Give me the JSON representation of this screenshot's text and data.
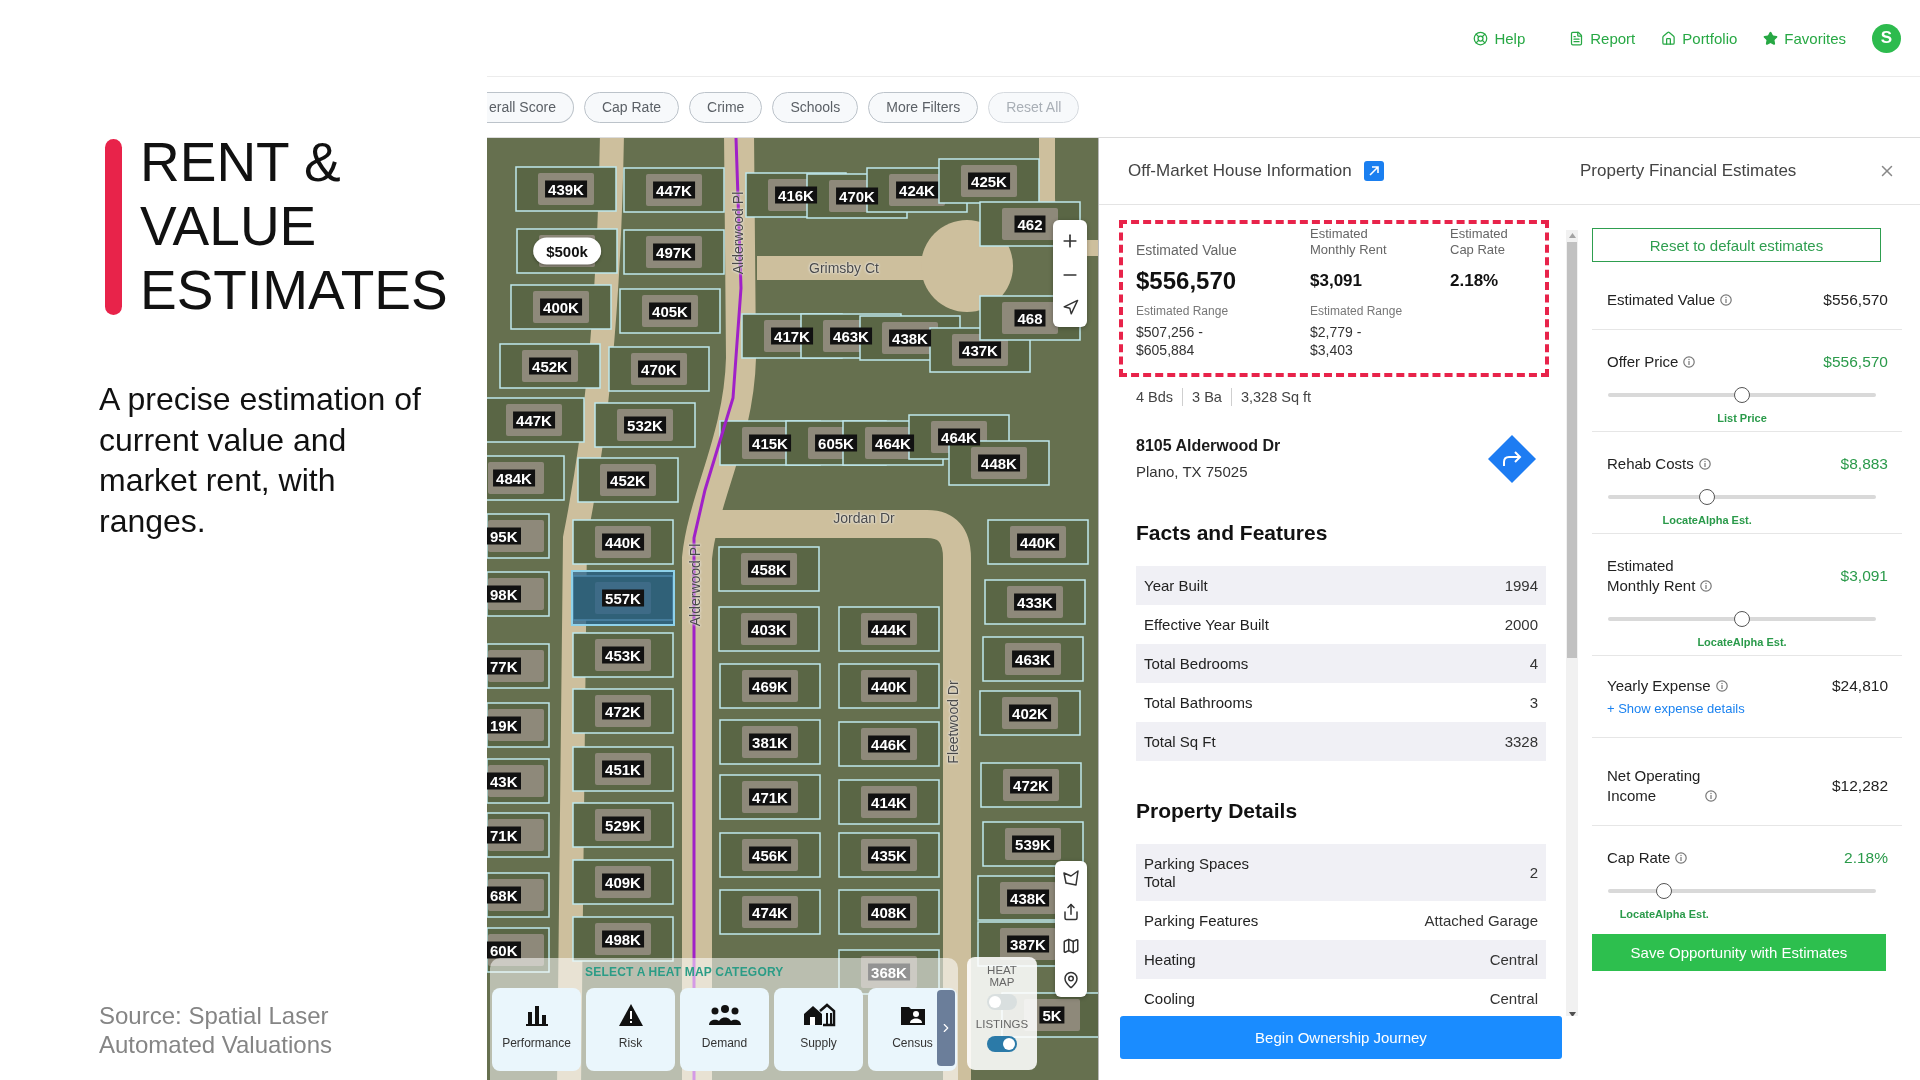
{
  "slide": {
    "title": "RENT & VALUE ESTIMATES",
    "summary": "A precise estimation of current value and market rent, with ranges.",
    "source": "Source: Spatial Laser Automated Valuations"
  },
  "top_nav": {
    "items": [
      {
        "kind": "help",
        "label": "Help"
      },
      {
        "kind": "report",
        "label": "Report"
      },
      {
        "kind": "portfolio",
        "label": "Portfolio"
      },
      {
        "kind": "favorites",
        "label": "Favorites"
      }
    ],
    "avatar": "S"
  },
  "filters": [
    {
      "label": "erall Score",
      "disabled": false
    },
    {
      "label": "Cap Rate",
      "disabled": false
    },
    {
      "label": "Crime",
      "disabled": false
    },
    {
      "label": "Schools",
      "disabled": false
    },
    {
      "label": "More Filters",
      "disabled": false
    },
    {
      "label": "Reset All",
      "disabled": true
    }
  ],
  "map": {
    "markers": [
      {
        "label": "439K",
        "kind": "price",
        "selected": false
      },
      {
        "label": "447K",
        "kind": "price",
        "selected": false
      },
      {
        "label": "416K",
        "kind": "price",
        "selected": false
      },
      {
        "label": "470K",
        "kind": "price",
        "selected": false
      },
      {
        "label": "424K",
        "kind": "price",
        "selected": false
      },
      {
        "label": "425K",
        "kind": "price",
        "selected": false
      },
      {
        "label": "462",
        "kind": "price",
        "selected": false
      },
      {
        "label": "$500k",
        "kind": "pill",
        "selected": false
      },
      {
        "label": "497K",
        "kind": "price",
        "selected": false
      },
      {
        "label": "400K",
        "kind": "price",
        "selected": false
      },
      {
        "label": "405K",
        "kind": "price",
        "selected": false
      },
      {
        "label": "417K",
        "kind": "price",
        "selected": false
      },
      {
        "label": "463K",
        "kind": "price",
        "selected": false
      },
      {
        "label": "438K",
        "kind": "price",
        "selected": false
      },
      {
        "label": "437K",
        "kind": "price",
        "selected": false
      },
      {
        "label": "468",
        "kind": "price",
        "selected": false
      },
      {
        "label": "452K",
        "kind": "price",
        "selected": false
      },
      {
        "label": "470K",
        "kind": "price",
        "selected": false
      },
      {
        "label": "447K",
        "kind": "price",
        "selected": false
      },
      {
        "label": "532K",
        "kind": "price",
        "selected": false
      },
      {
        "label": "415K",
        "kind": "price",
        "selected": false
      },
      {
        "label": "605K",
        "kind": "price",
        "selected": false
      },
      {
        "label": "464K",
        "kind": "price",
        "selected": false
      },
      {
        "label": "464K",
        "kind": "price",
        "selected": false
      },
      {
        "label": "448K",
        "kind": "price",
        "selected": false
      },
      {
        "label": "484K",
        "kind": "price",
        "selected": false
      },
      {
        "label": "452K",
        "kind": "price",
        "selected": false
      },
      {
        "label": "95K",
        "kind": "price",
        "selected": false
      },
      {
        "label": "440K",
        "kind": "price",
        "selected": false
      },
      {
        "label": "440K",
        "kind": "price",
        "selected": false
      },
      {
        "label": "458K",
        "kind": "price",
        "selected": false
      },
      {
        "label": "98K",
        "kind": "price",
        "selected": false
      },
      {
        "label": "557K",
        "kind": "price",
        "selected": true
      },
      {
        "label": "433K",
        "kind": "price",
        "selected": false
      },
      {
        "label": "403K",
        "kind": "price",
        "selected": false
      },
      {
        "label": "444K",
        "kind": "price",
        "selected": false
      },
      {
        "label": "453K",
        "kind": "price",
        "selected": false
      },
      {
        "label": "77K",
        "kind": "price",
        "selected": false
      },
      {
        "label": "463K",
        "kind": "price",
        "selected": false
      },
      {
        "label": "469K",
        "kind": "price",
        "selected": false
      },
      {
        "label": "440K",
        "kind": "price",
        "selected": false
      },
      {
        "label": "472K",
        "kind": "price",
        "selected": false
      },
      {
        "label": "19K",
        "kind": "price",
        "selected": false
      },
      {
        "label": "402K",
        "kind": "price",
        "selected": false
      },
      {
        "label": "381K",
        "kind": "price",
        "selected": false
      },
      {
        "label": "446K",
        "kind": "price",
        "selected": false
      },
      {
        "label": "451K",
        "kind": "price",
        "selected": false
      },
      {
        "label": "43K",
        "kind": "price",
        "selected": false
      },
      {
        "label": "471K",
        "kind": "price",
        "selected": false
      },
      {
        "label": "414K",
        "kind": "price",
        "selected": false
      },
      {
        "label": "472K",
        "kind": "price",
        "selected": false
      },
      {
        "label": "71K",
        "kind": "price",
        "selected": false
      },
      {
        "label": "529K",
        "kind": "price",
        "selected": false
      },
      {
        "label": "539K",
        "kind": "price",
        "selected": false
      },
      {
        "label": "456K",
        "kind": "price",
        "selected": false
      },
      {
        "label": "435K",
        "kind": "price",
        "selected": false
      },
      {
        "label": "409K",
        "kind": "price",
        "selected": false
      },
      {
        "label": "68K",
        "kind": "price",
        "selected": false
      },
      {
        "label": "438K",
        "kind": "price",
        "selected": false
      },
      {
        "label": "474K",
        "kind": "price",
        "selected": false
      },
      {
        "label": "408K",
        "kind": "price",
        "selected": false
      },
      {
        "label": "498K",
        "kind": "price",
        "selected": false
      },
      {
        "label": "60K",
        "kind": "price",
        "selected": false
      },
      {
        "label": "387K",
        "kind": "price",
        "selected": false
      },
      {
        "label": "368K",
        "kind": "price",
        "selected": false
      },
      {
        "label": "5K",
        "kind": "price",
        "selected": false
      }
    ],
    "streets": [
      "Alderwood Pl",
      "Grimsby Ct",
      "Jordan Dr",
      "Alderwood Pl",
      "Fleetwood Dr"
    ],
    "heat_map": {
      "title": "SELECT A HEAT MAP CATEGORY",
      "categories": [
        {
          "kind": "performance",
          "label": "Performance"
        },
        {
          "kind": "risk",
          "label": "Risk"
        },
        {
          "kind": "demand",
          "label": "Demand"
        },
        {
          "kind": "supply",
          "label": "Supply"
        },
        {
          "kind": "census",
          "label": "Census"
        }
      ]
    },
    "layers": [
      {
        "label": "HEAT MAP",
        "on": false
      },
      {
        "label": "LISTINGS",
        "on": true
      }
    ]
  },
  "house_info": {
    "title": "Off-Market House Information",
    "estimates": [
      {
        "kind": "primary",
        "label": "Estimated Value",
        "value": "$556,570",
        "range_label": "Estimated Range",
        "range": "$507,256 -\n$605,884"
      },
      {
        "kind": "secondary",
        "label": "Estimated\nMonthly Rent",
        "value": "$3,091",
        "range_label": "Estimated Range",
        "range": "$2,779 -\n$3,403"
      },
      {
        "kind": "secondary",
        "label": "Estimated\nCap Rate",
        "value": "2.18%"
      }
    ],
    "stats": [
      "4 Bds",
      "3 Ba",
      "3,328 Sq ft"
    ],
    "address": "8105 Alderwood Dr",
    "city": "Plano, TX 75025",
    "sections": [
      {
        "title": "Facts and Features",
        "rows": [
          {
            "label": "Year Built",
            "value": "1994"
          },
          {
            "label": "Effective Year Built",
            "value": "2000"
          },
          {
            "label": "Total Bedrooms",
            "value": "4"
          },
          {
            "label": "Total Bathrooms",
            "value": "3"
          },
          {
            "label": "Total Sq Ft",
            "value": "3328"
          }
        ]
      },
      {
        "title": "Property Details",
        "rows": [
          {
            "label": "Parking Spaces\nTotal",
            "value": "2"
          },
          {
            "label": "Parking Features",
            "value": "Attached Garage"
          },
          {
            "label": "Heating",
            "value": "Central"
          },
          {
            "label": "Cooling",
            "value": "Central"
          }
        ]
      }
    ],
    "action": "Begin Ownership Journey"
  },
  "financials": {
    "title": "Property Financial Estimates",
    "reset": "Reset to default estimates",
    "rows": [
      {
        "kind": "plain",
        "label": "Estimated Value",
        "value": "$556,570"
      },
      {
        "kind": "slider",
        "label": "Offer Price",
        "value": "$556,570",
        "level": 0.5,
        "caption": "List Price"
      },
      {
        "kind": "slider",
        "label": "Rehab Costs",
        "value": "$8,883",
        "level": 0.37,
        "caption": "LocateAlpha Est."
      },
      {
        "kind": "slider",
        "label": "Estimated\nMonthly Rent",
        "value": "$3,091",
        "level": 0.5,
        "caption": "LocateAlpha Est."
      },
      {
        "kind": "details",
        "label": "Yearly Expense",
        "value": "$24,810",
        "link": "+ Show expense details"
      },
      {
        "kind": "plain",
        "label": "Net Operating\nIncome",
        "value": "$12,282"
      },
      {
        "kind": "slider",
        "label": "Cap Rate",
        "value": "2.18%",
        "level": 0.21,
        "caption": "LocateAlpha Est."
      }
    ],
    "save": "Save Opportunity with Estimates"
  }
}
